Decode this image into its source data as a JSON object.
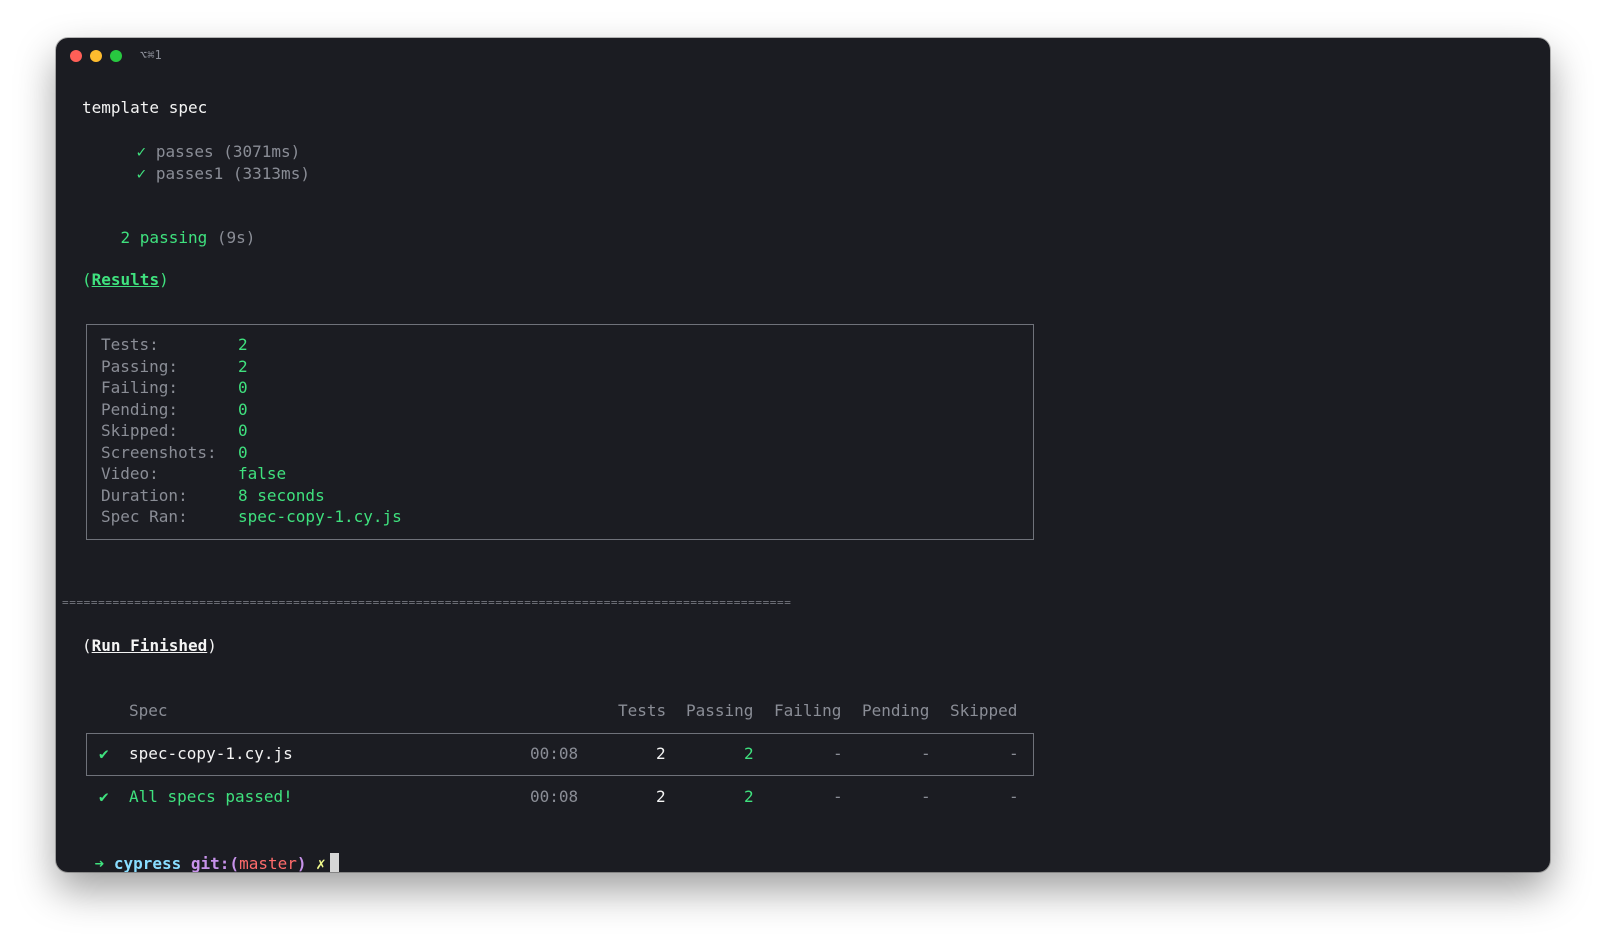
{
  "window": {
    "shortcut": "⌥⌘1"
  },
  "spec_run": {
    "suite": "template spec",
    "tests": [
      {
        "check": "✓",
        "name": "passes",
        "time": "(3071ms)"
      },
      {
        "check": "✓",
        "name": "passes1",
        "time": "(3313ms)"
      }
    ],
    "summary_count": "2 passing",
    "summary_time": "(9s)"
  },
  "results": {
    "heading": "Results",
    "rows": [
      {
        "key": "Tests:",
        "value": "2"
      },
      {
        "key": "Passing:",
        "value": "2"
      },
      {
        "key": "Failing:",
        "value": "0"
      },
      {
        "key": "Pending:",
        "value": "0"
      },
      {
        "key": "Skipped:",
        "value": "0"
      },
      {
        "key": "Screenshots:",
        "value": "0"
      },
      {
        "key": "Video:",
        "value": "false"
      },
      {
        "key": "Duration:",
        "value": "8 seconds"
      },
      {
        "key": "Spec Ran:",
        "value": "spec-copy-1.cy.js"
      }
    ]
  },
  "divider": "=====================================================================================================",
  "run_finished": {
    "heading": "Run Finished",
    "headers": {
      "spec": "Spec",
      "tests": "Tests",
      "passing": "Passing",
      "failing": "Failing",
      "pending": "Pending",
      "skipped": "Skipped"
    },
    "row": {
      "check": "✔",
      "spec": "spec-copy-1.cy.js",
      "duration": "00:08",
      "tests": "2",
      "passing": "2",
      "failing": "-",
      "pending": "-",
      "skipped": "-"
    },
    "total": {
      "check": "✔",
      "label": "All specs passed!",
      "duration": "00:08",
      "tests": "2",
      "passing": "2",
      "failing": "-",
      "pending": "-",
      "skipped": "-"
    }
  },
  "prompt": {
    "arrow": "➜",
    "dir": "cypress",
    "git_prefix": "git:(",
    "branch": "master",
    "git_suffix": ")",
    "dirty": "✗"
  },
  "colors": {
    "green": "#3fe17e",
    "dim": "#8a8d96",
    "branch": "#ff6b6b",
    "git": "#c792ea",
    "dir": "#89ddff",
    "dirty": "#f1fa8c"
  }
}
